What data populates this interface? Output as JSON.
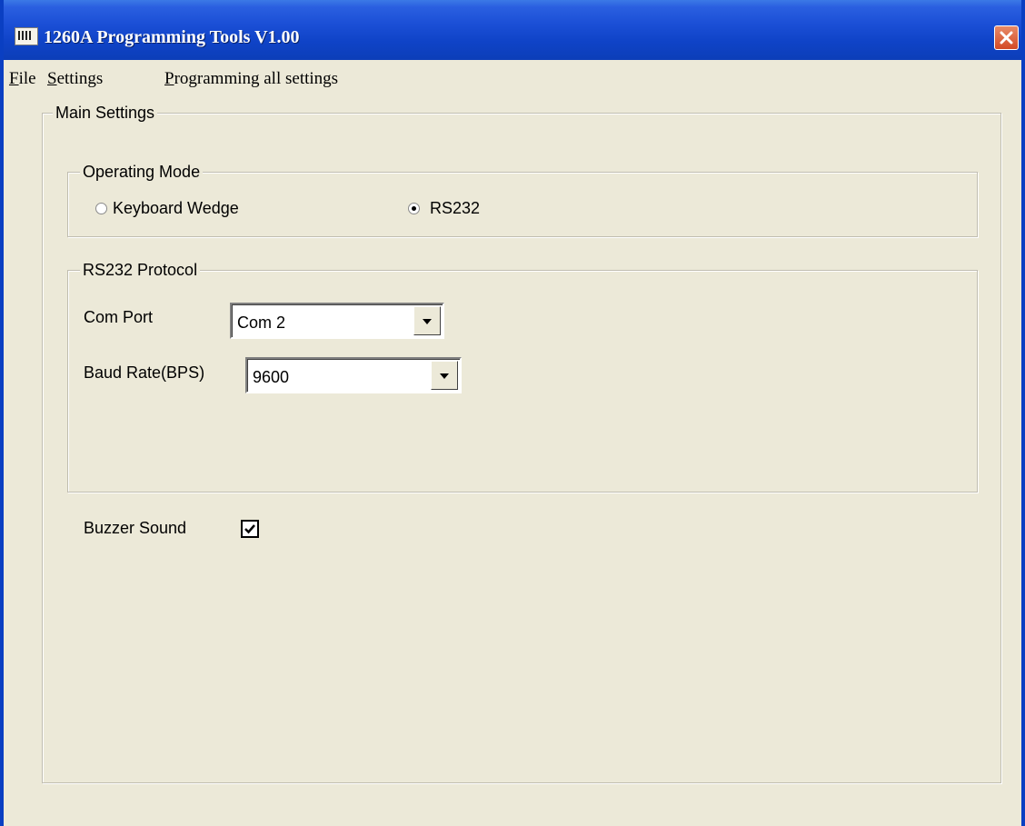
{
  "window": {
    "title": "1260A Programming Tools V1.00",
    "title_icon": "app-icon",
    "close_icon": "close-icon"
  },
  "menu": {
    "items": [
      {
        "label_u": "F",
        "label_rest": "ile"
      },
      {
        "label_u": "S",
        "label_rest": "ettings"
      },
      {
        "label_u": "P",
        "label_rest": "rogramming all settings"
      }
    ]
  },
  "main_settings": {
    "legend": "Main Settings",
    "operating_mode": {
      "legend": "Operating Mode",
      "options": [
        {
          "label": "Keyboard Wedge",
          "selected": false
        },
        {
          "label": "RS232",
          "selected": true
        }
      ]
    },
    "rs232_protocol": {
      "legend": "RS232 Protocol",
      "com_port_label": "Com Port",
      "com_port_value": "Com 2",
      "baud_rate_label": "Baud Rate(BPS)",
      "baud_rate_value": "9600"
    },
    "buzzer": {
      "label": "Buzzer Sound",
      "checked": true
    }
  },
  "colors": {
    "titlebar": "#0f43c7",
    "background": "#ece9d8"
  }
}
